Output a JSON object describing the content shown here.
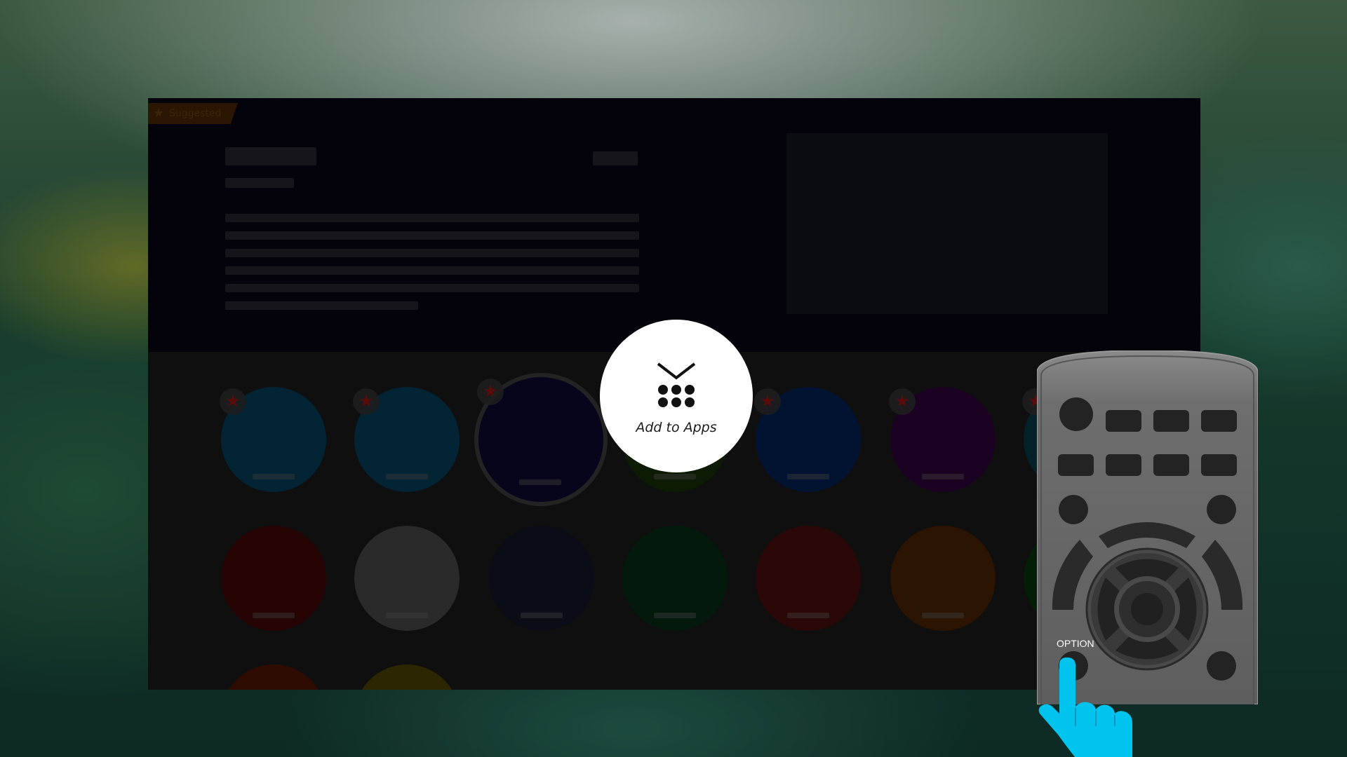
{
  "screen": {
    "badge": {
      "label": "Suggested",
      "icon": "star-icon"
    }
  },
  "popup": {
    "label": "Add to Apps",
    "icon": "add-to-apps-icon"
  },
  "remote": {
    "option_label": "OPTION",
    "pointer_icon": "hand-pointer-icon"
  },
  "colors": {
    "popup_bg": "#ffffff",
    "hand": "#00c4ee",
    "remote_body": "#6b6b6b"
  }
}
